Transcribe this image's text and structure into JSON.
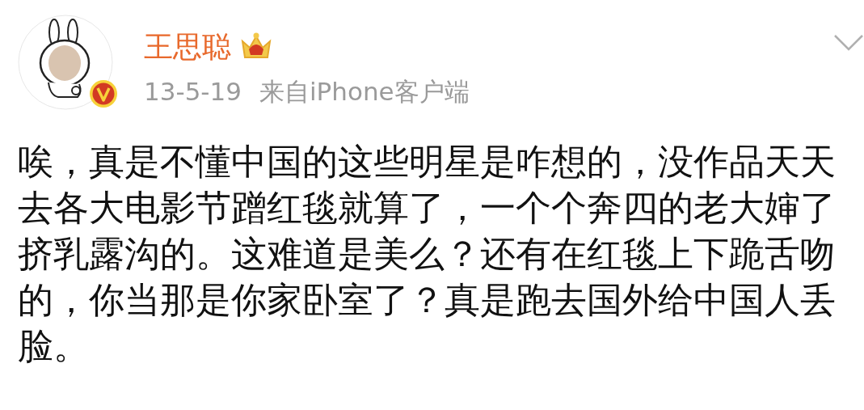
{
  "post": {
    "author": {
      "name": "王思聪",
      "verified": true
    },
    "date": "13-5-19",
    "source": "来自iPhone客户端",
    "text": "唉，真是不懂中国的这些明星是咋想的，没作品天天去各大电影节蹭红毯就算了，一个个奔四的老大婶了挤乳露沟的。这难道是美么？还有在红毯上下跪舌吻的，你当那是你家卧室了？真是跑去国外给中国人丢脸。"
  }
}
